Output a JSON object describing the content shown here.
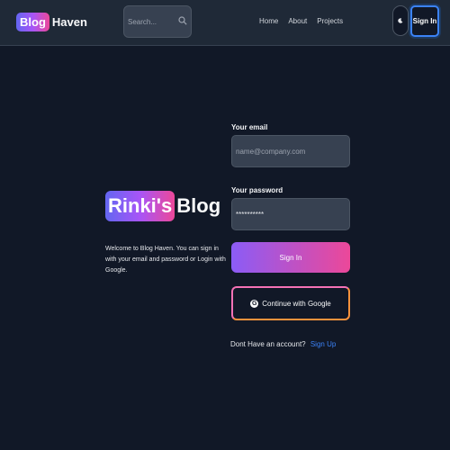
{
  "header": {
    "logo_badge": "Blog",
    "logo_text": "Haven",
    "search": {
      "placeholder": "Search..."
    },
    "nav": [
      "Home",
      "About",
      "Projects"
    ],
    "theme_icon": "moon-icon",
    "signin_label": "Sign In"
  },
  "intro": {
    "brand_badge": "Rinki's",
    "brand_text": "Blog",
    "description": "Welcome to Blog Haven. You can sign in with your email and password or Login with Google."
  },
  "form": {
    "email_label": "Your email",
    "email_placeholder": "name@company.com",
    "password_label": "Your password",
    "password_value": "**********",
    "signin_button": "Sign In",
    "google_button": "Continue with Google",
    "account_prompt": "Dont Have an account?",
    "signup_link": "Sign Up"
  },
  "colors": {
    "background": "#111827",
    "header": "#1f2937",
    "accent_start": "#8b5cf6",
    "accent_end": "#ec4899",
    "link": "#3b82f6"
  }
}
